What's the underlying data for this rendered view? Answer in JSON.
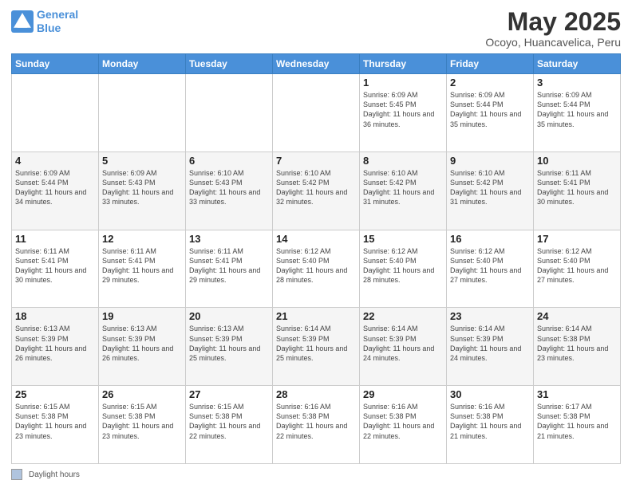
{
  "header": {
    "logo_line1": "General",
    "logo_line2": "Blue",
    "title": "May 2025",
    "subtitle": "Ocoyo, Huancavelica, Peru"
  },
  "weekdays": [
    "Sunday",
    "Monday",
    "Tuesday",
    "Wednesday",
    "Thursday",
    "Friday",
    "Saturday"
  ],
  "footer": {
    "legend_label": "Daylight hours"
  },
  "weeks": [
    [
      {
        "num": "",
        "info": ""
      },
      {
        "num": "",
        "info": ""
      },
      {
        "num": "",
        "info": ""
      },
      {
        "num": "",
        "info": ""
      },
      {
        "num": "1",
        "info": "Sunrise: 6:09 AM\nSunset: 5:45 PM\nDaylight: 11 hours and 36 minutes."
      },
      {
        "num": "2",
        "info": "Sunrise: 6:09 AM\nSunset: 5:44 PM\nDaylight: 11 hours and 35 minutes."
      },
      {
        "num": "3",
        "info": "Sunrise: 6:09 AM\nSunset: 5:44 PM\nDaylight: 11 hours and 35 minutes."
      }
    ],
    [
      {
        "num": "4",
        "info": "Sunrise: 6:09 AM\nSunset: 5:44 PM\nDaylight: 11 hours and 34 minutes."
      },
      {
        "num": "5",
        "info": "Sunrise: 6:09 AM\nSunset: 5:43 PM\nDaylight: 11 hours and 33 minutes."
      },
      {
        "num": "6",
        "info": "Sunrise: 6:10 AM\nSunset: 5:43 PM\nDaylight: 11 hours and 33 minutes."
      },
      {
        "num": "7",
        "info": "Sunrise: 6:10 AM\nSunset: 5:42 PM\nDaylight: 11 hours and 32 minutes."
      },
      {
        "num": "8",
        "info": "Sunrise: 6:10 AM\nSunset: 5:42 PM\nDaylight: 11 hours and 31 minutes."
      },
      {
        "num": "9",
        "info": "Sunrise: 6:10 AM\nSunset: 5:42 PM\nDaylight: 11 hours and 31 minutes."
      },
      {
        "num": "10",
        "info": "Sunrise: 6:11 AM\nSunset: 5:41 PM\nDaylight: 11 hours and 30 minutes."
      }
    ],
    [
      {
        "num": "11",
        "info": "Sunrise: 6:11 AM\nSunset: 5:41 PM\nDaylight: 11 hours and 30 minutes."
      },
      {
        "num": "12",
        "info": "Sunrise: 6:11 AM\nSunset: 5:41 PM\nDaylight: 11 hours and 29 minutes."
      },
      {
        "num": "13",
        "info": "Sunrise: 6:11 AM\nSunset: 5:41 PM\nDaylight: 11 hours and 29 minutes."
      },
      {
        "num": "14",
        "info": "Sunrise: 6:12 AM\nSunset: 5:40 PM\nDaylight: 11 hours and 28 minutes."
      },
      {
        "num": "15",
        "info": "Sunrise: 6:12 AM\nSunset: 5:40 PM\nDaylight: 11 hours and 28 minutes."
      },
      {
        "num": "16",
        "info": "Sunrise: 6:12 AM\nSunset: 5:40 PM\nDaylight: 11 hours and 27 minutes."
      },
      {
        "num": "17",
        "info": "Sunrise: 6:12 AM\nSunset: 5:40 PM\nDaylight: 11 hours and 27 minutes."
      }
    ],
    [
      {
        "num": "18",
        "info": "Sunrise: 6:13 AM\nSunset: 5:39 PM\nDaylight: 11 hours and 26 minutes."
      },
      {
        "num": "19",
        "info": "Sunrise: 6:13 AM\nSunset: 5:39 PM\nDaylight: 11 hours and 26 minutes."
      },
      {
        "num": "20",
        "info": "Sunrise: 6:13 AM\nSunset: 5:39 PM\nDaylight: 11 hours and 25 minutes."
      },
      {
        "num": "21",
        "info": "Sunrise: 6:14 AM\nSunset: 5:39 PM\nDaylight: 11 hours and 25 minutes."
      },
      {
        "num": "22",
        "info": "Sunrise: 6:14 AM\nSunset: 5:39 PM\nDaylight: 11 hours and 24 minutes."
      },
      {
        "num": "23",
        "info": "Sunrise: 6:14 AM\nSunset: 5:39 PM\nDaylight: 11 hours and 24 minutes."
      },
      {
        "num": "24",
        "info": "Sunrise: 6:14 AM\nSunset: 5:38 PM\nDaylight: 11 hours and 23 minutes."
      }
    ],
    [
      {
        "num": "25",
        "info": "Sunrise: 6:15 AM\nSunset: 5:38 PM\nDaylight: 11 hours and 23 minutes."
      },
      {
        "num": "26",
        "info": "Sunrise: 6:15 AM\nSunset: 5:38 PM\nDaylight: 11 hours and 23 minutes."
      },
      {
        "num": "27",
        "info": "Sunrise: 6:15 AM\nSunset: 5:38 PM\nDaylight: 11 hours and 22 minutes."
      },
      {
        "num": "28",
        "info": "Sunrise: 6:16 AM\nSunset: 5:38 PM\nDaylight: 11 hours and 22 minutes."
      },
      {
        "num": "29",
        "info": "Sunrise: 6:16 AM\nSunset: 5:38 PM\nDaylight: 11 hours and 22 minutes."
      },
      {
        "num": "30",
        "info": "Sunrise: 6:16 AM\nSunset: 5:38 PM\nDaylight: 11 hours and 21 minutes."
      },
      {
        "num": "31",
        "info": "Sunrise: 6:17 AM\nSunset: 5:38 PM\nDaylight: 11 hours and 21 minutes."
      }
    ]
  ]
}
